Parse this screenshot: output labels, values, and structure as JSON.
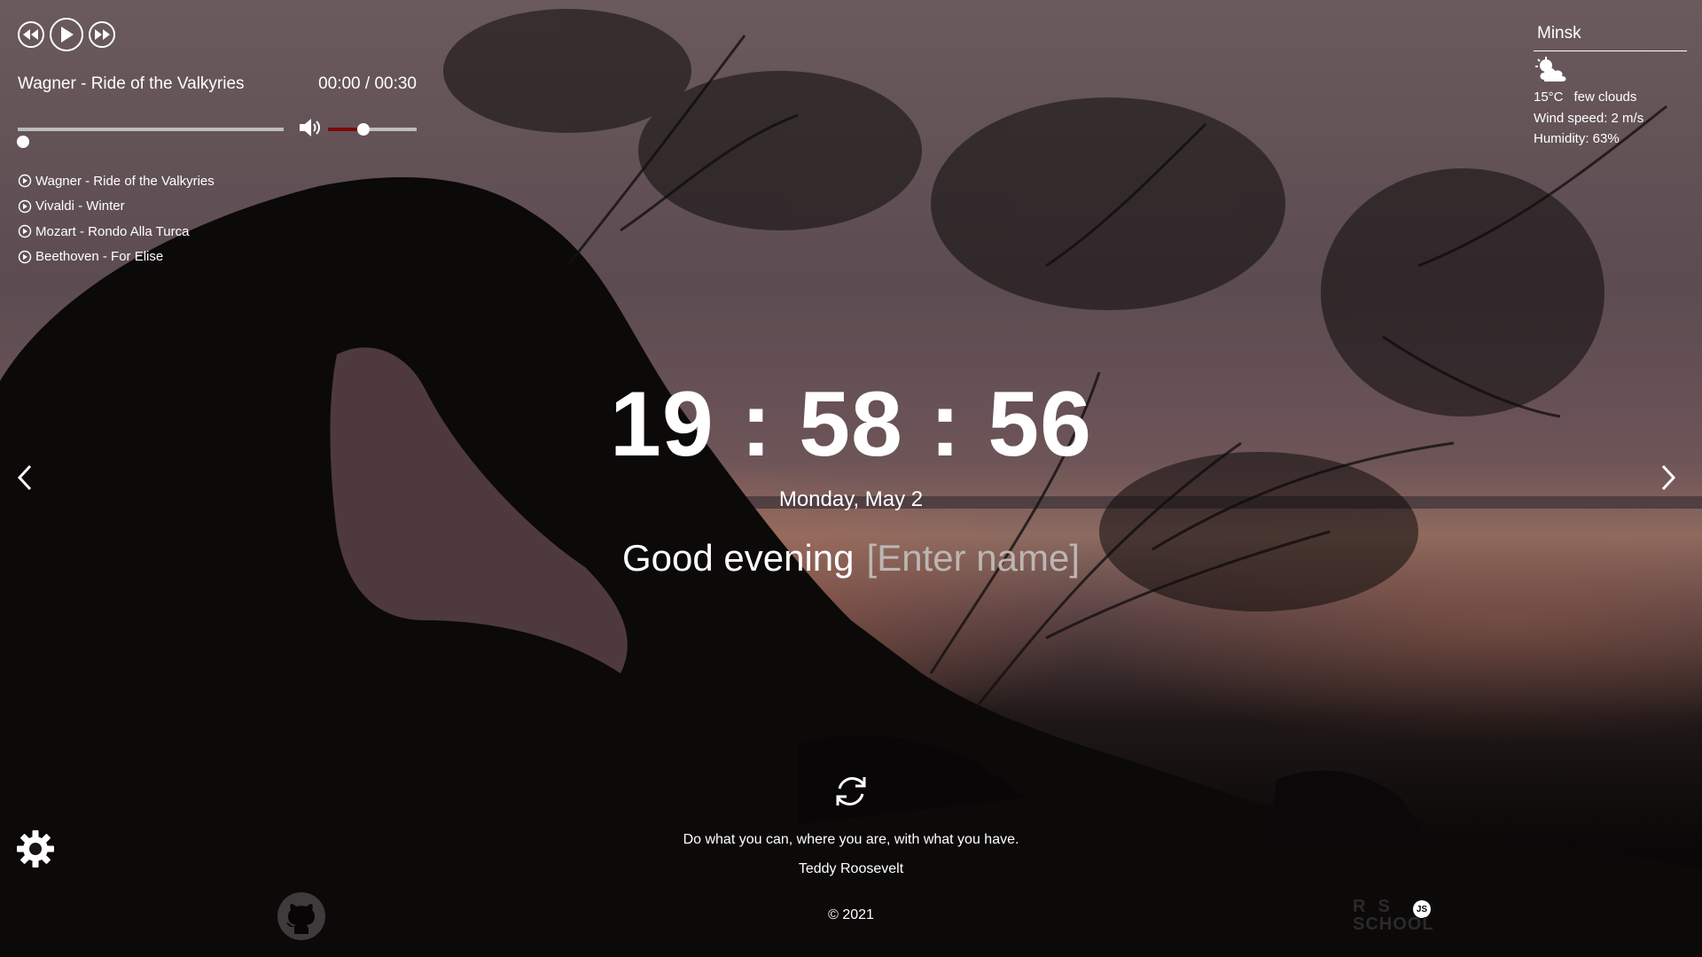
{
  "player": {
    "current_track": "Wagner - Ride of the Valkyries",
    "time_display": "00:00 / 00:30",
    "progress_fraction": 0,
    "volume_fraction": 0.4,
    "playlist": [
      "Wagner - Ride of the Valkyries",
      "Vivaldi - Winter",
      "Mozart - Rondo Alla Turca",
      "Beethoven - For Elise"
    ]
  },
  "weather": {
    "city": "Minsk",
    "temperature": "15°C",
    "description": "few clouds",
    "wind": "Wind speed: 2 m/s",
    "humidity": "Humidity: 63%",
    "icon": "few-clouds-icon"
  },
  "clock": {
    "time": "19 : 58 : 56",
    "date": "Monday, May 2"
  },
  "greeting": {
    "text": "Good evening",
    "name_placeholder": "[Enter name]"
  },
  "quote": {
    "text": "Do what you can, where you are, with what you have.",
    "author": "Teddy Roosevelt"
  },
  "footer": {
    "copyright": "© 2021",
    "logo_line1": "RS",
    "logo_line2": "SCHOOL",
    "logo_badge": "JS"
  }
}
